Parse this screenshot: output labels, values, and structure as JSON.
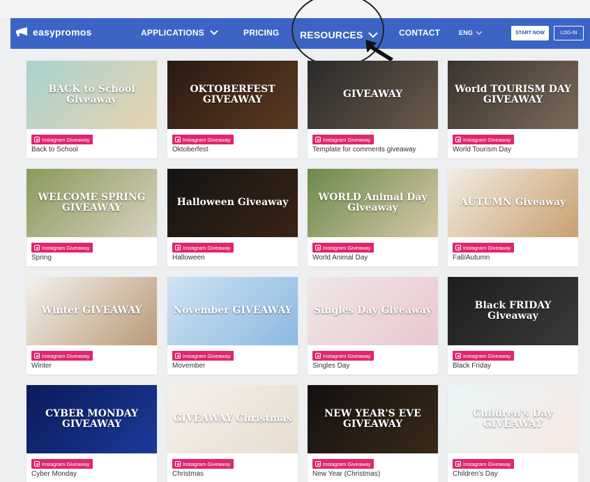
{
  "header": {
    "logo": "easypromos",
    "nav": [
      {
        "label": "APPLICATIONS"
      },
      {
        "label": "PRICING"
      },
      {
        "label": "RESOURCES"
      },
      {
        "label": "CONTACT"
      },
      {
        "label": "ENG"
      }
    ],
    "start_now": "START NOW",
    "login": "LOG-IN"
  },
  "cards": [
    {
      "tag": "Instagram Giveaway",
      "name": "Back to School",
      "thumb": "BACK to School Giveaway",
      "bg": [
        "#a8d3cf",
        "#e8d3b0"
      ]
    },
    {
      "tag": "Instagram Giveaway",
      "name": "Oktoberfest",
      "thumb": "OKTOBERFEST GIVEAWAY",
      "bg": [
        "#2b1a12",
        "#5a3a22"
      ]
    },
    {
      "tag": "Instagram Giveaway",
      "name": "Template for comments giveaway",
      "thumb": "GIVEAWAY",
      "bg": [
        "#2a2a2a",
        "#6b5a4a"
      ]
    },
    {
      "tag": "Instagram Giveaway",
      "name": "World Tourism Day",
      "thumb": "World TOURISM DAY GIVEAWAY",
      "bg": [
        "#3a3430",
        "#7b6a58"
      ]
    },
    {
      "tag": "Instagram Giveaway",
      "name": "Spring",
      "thumb": "WELCOME SPRING GIVEAWAY",
      "bg": [
        "#8a9a5a",
        "#d8d0c0"
      ]
    },
    {
      "tag": "Instagram Giveaway",
      "name": "Halloween",
      "thumb": "Halloween Giveaway",
      "bg": [
        "#141414",
        "#3a2414"
      ]
    },
    {
      "tag": "Instagram Giveaway",
      "name": "World Animal Day",
      "thumb": "WORLD Animal Day Giveaway",
      "bg": [
        "#6a8a4a",
        "#d8c8a8"
      ]
    },
    {
      "tag": "Instagram Giveaway",
      "name": "Fall/Autumn",
      "thumb": "AUTUMN Giveaway",
      "bg": [
        "#f2ece2",
        "#c8a070"
      ]
    },
    {
      "tag": "Instagram Giveaway",
      "name": "Winter",
      "thumb": "Winter GIVEAWAY",
      "bg": [
        "#f4f1ec",
        "#b89a78"
      ]
    },
    {
      "tag": "Instagram Giveaway",
      "name": "Movember",
      "thumb": "November GIVEAWAY",
      "bg": [
        "#cfe3f3",
        "#8cb8e0"
      ]
    },
    {
      "tag": "Instagram Giveaway",
      "name": "Singles Day",
      "thumb": "Singles Day Giveaway",
      "bg": [
        "#f0e6e6",
        "#e8c8d0"
      ]
    },
    {
      "tag": "Instagram Giveaway",
      "name": "Black Friday",
      "thumb": "Black FRIDAY Giveaway",
      "bg": [
        "#1e1e1e",
        "#3a3a3a"
      ]
    },
    {
      "tag": "Instagram Giveaway",
      "name": "Cyber Monday",
      "thumb": "CYBER MONDAY GIVEAWAY",
      "bg": [
        "#0c1a5a",
        "#1a3a9a"
      ]
    },
    {
      "tag": "Instagram Giveaway",
      "name": "Christmas",
      "thumb": "GIVEAWAY Christmas",
      "bg": [
        "#f4f0ea",
        "#e8ddd0"
      ]
    },
    {
      "tag": "Instagram Giveaway",
      "name": "New Year (Christmas)",
      "thumb": "NEW YEAR'S EVE GIVEAWAY",
      "bg": [
        "#141010",
        "#3a2a18"
      ]
    },
    {
      "tag": "Instagram Giveaway",
      "name": "Children's Day",
      "thumb": "Children's Day GIVEAWAY",
      "bg": [
        "#eaf6f6",
        "#f8e8e4"
      ]
    }
  ],
  "colors": {
    "navbar": "#3b64c5",
    "tag": "#e0266e",
    "page_bg": "#eeeff1"
  }
}
